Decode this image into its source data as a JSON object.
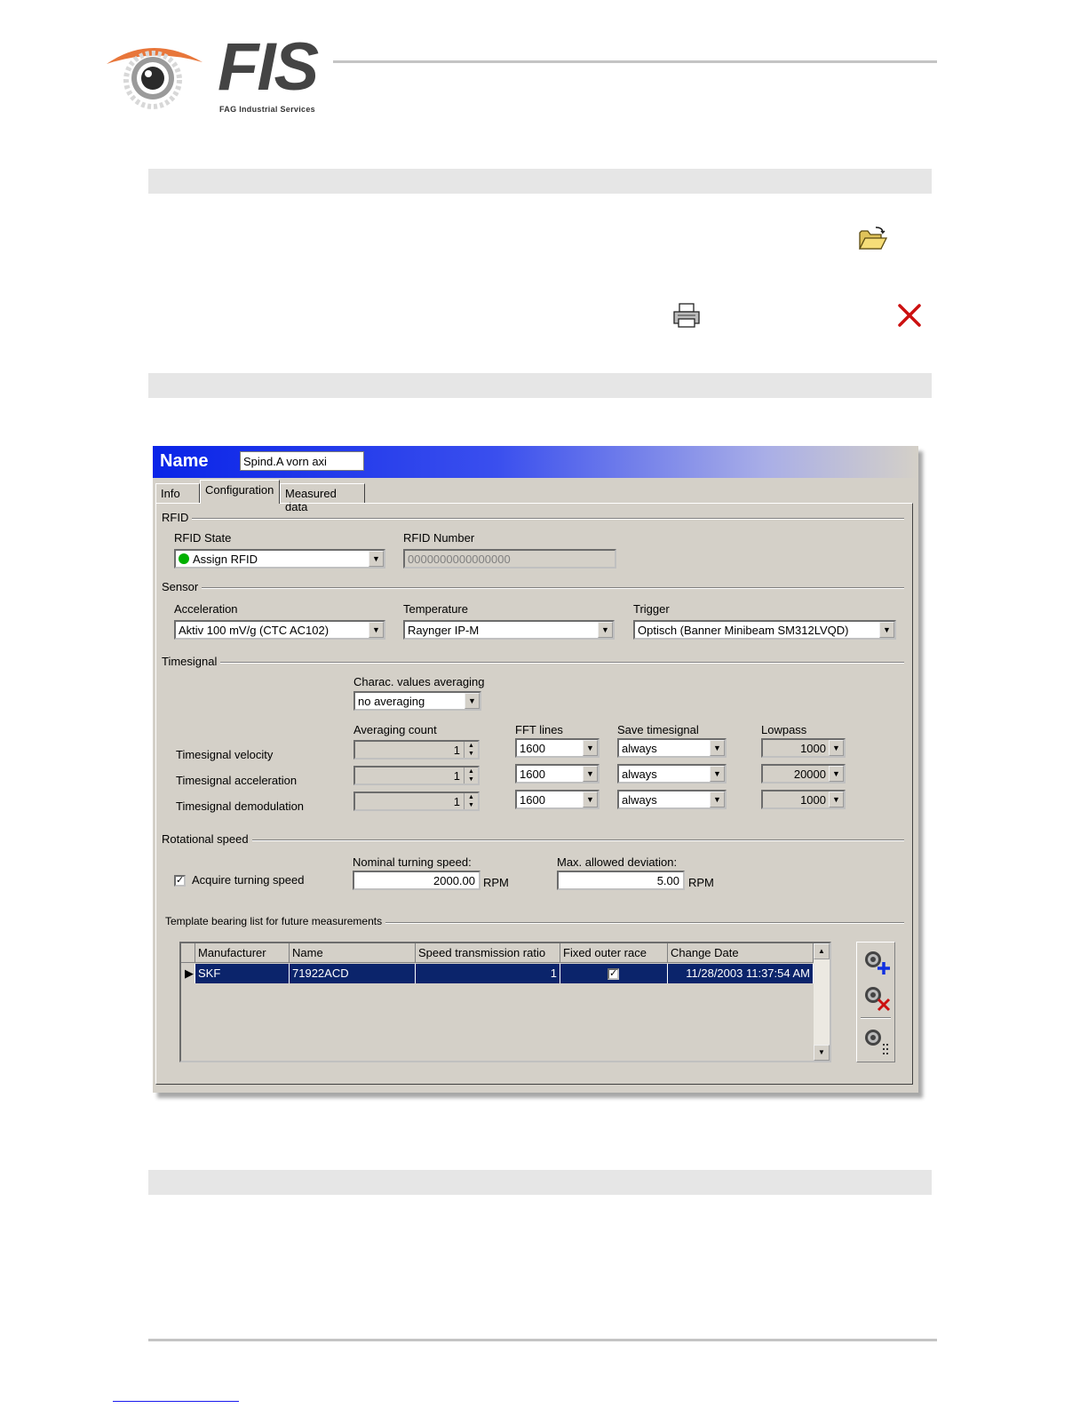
{
  "logo": {
    "brand": "FIS",
    "subtitle": "FAG Industrial Services"
  },
  "window": {
    "title_label": "Name",
    "name_value": "Spind.A vorn axi",
    "tabs": [
      {
        "label": "Info",
        "active": false
      },
      {
        "label": "Configuration",
        "active": true
      },
      {
        "label": "Measured data",
        "active": false
      }
    ]
  },
  "rfid": {
    "group_label": "RFID",
    "state_label": "RFID State",
    "state_value": "Assign RFID",
    "state_color": "#00b000",
    "number_label": "RFID Number",
    "number_value": "0000000000000000"
  },
  "sensor": {
    "group_label": "Sensor",
    "acceleration_label": "Acceleration",
    "acceleration_value": "Aktiv 100 mV/g (CTC AC102)",
    "temperature_label": "Temperature",
    "temperature_value": "Raynger IP-M",
    "trigger_label": "Trigger",
    "trigger_value": "Optisch (Banner Minibeam SM312LVQD)"
  },
  "timesignal": {
    "group_label": "Timesignal",
    "charac_label": "Charac. values averaging",
    "charac_value": "no averaging",
    "col_averaging": "Averaging count",
    "col_fft": "FFT lines",
    "col_save": "Save timesignal",
    "col_lowpass": "Lowpass",
    "rows": [
      {
        "label": "Timesignal velocity",
        "count": "1",
        "fft": "1600",
        "save": "always",
        "lowpass": "1000"
      },
      {
        "label": "Timesignal acceleration",
        "count": "1",
        "fft": "1600",
        "save": "always",
        "lowpass": "20000"
      },
      {
        "label": "Timesignal demodulation",
        "count": "1",
        "fft": "1600",
        "save": "always",
        "lowpass": "1000"
      }
    ]
  },
  "rotational": {
    "group_label": "Rotational speed",
    "acquire_label": "Acquire turning speed",
    "acquire_checked": true,
    "nominal_label": "Nominal turning speed:",
    "nominal_value": "2000.00",
    "nominal_unit": "RPM",
    "deviation_label": "Max. allowed deviation:",
    "deviation_value": "5.00",
    "deviation_unit": "RPM"
  },
  "template": {
    "group_label": "Template bearing list for future measurements",
    "columns": [
      "Manufacturer",
      "Name",
      "Speed transmission ratio",
      "Fixed outer race",
      "Change Date"
    ],
    "rows": [
      {
        "manufacturer": "SKF",
        "name": "71922ACD",
        "ratio": "1",
        "fixed": true,
        "date": "11/28/2003 11:37:54 AM"
      }
    ]
  },
  "icons": {
    "open_folder": "open-folder-icon",
    "printer": "printer-icon",
    "close": "close-x-icon",
    "close_color": "#cc1010",
    "add_bearing": "add-bearing-icon",
    "remove_bearing": "remove-bearing-icon",
    "bearing_details": "bearing-details-icon"
  }
}
